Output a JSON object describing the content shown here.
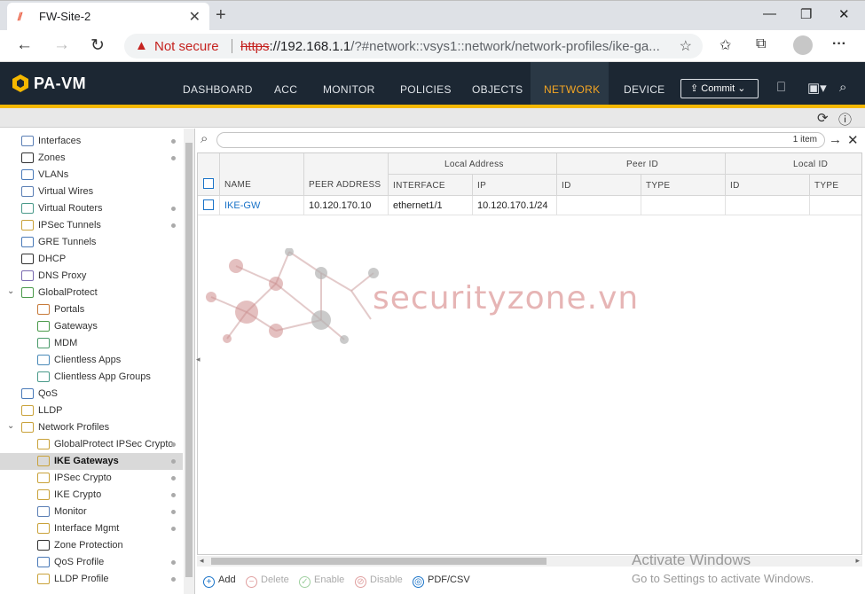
{
  "browser": {
    "tab_title": "FW-Site-2",
    "tab_close": "✕",
    "new_tab": "+",
    "not_secure": "Not secure",
    "url_scheme": "https",
    "url_host": "://192.168.1.1",
    "url_path": "/?#network::vsys1::network/network-profiles/ike-ga..."
  },
  "app": {
    "logo": "PA-VM",
    "nav": [
      "DASHBOARD",
      "ACC",
      "MONITOR",
      "POLICIES",
      "OBJECTS",
      "NETWORK",
      "DEVICE"
    ],
    "active_nav": "NETWORK",
    "commit_label": "Commit"
  },
  "sidebar": {
    "items": [
      {
        "label": "Interfaces",
        "dot": true
      },
      {
        "label": "Zones",
        "dot": true
      },
      {
        "label": "VLANs",
        "dot": false
      },
      {
        "label": "Virtual Wires",
        "dot": false
      },
      {
        "label": "Virtual Routers",
        "dot": true
      },
      {
        "label": "IPSec Tunnels",
        "dot": true
      },
      {
        "label": "GRE Tunnels",
        "dot": false
      },
      {
        "label": "DHCP",
        "dot": false
      },
      {
        "label": "DNS Proxy",
        "dot": false
      },
      {
        "label": "GlobalProtect",
        "dot": false
      },
      {
        "label": "Portals",
        "dot": false
      },
      {
        "label": "Gateways",
        "dot": false
      },
      {
        "label": "MDM",
        "dot": false
      },
      {
        "label": "Clientless Apps",
        "dot": false
      },
      {
        "label": "Clientless App Groups",
        "dot": false
      },
      {
        "label": "QoS",
        "dot": false
      },
      {
        "label": "LLDP",
        "dot": false
      },
      {
        "label": "Network Profiles",
        "dot": false
      },
      {
        "label": "GlobalProtect IPSec Crypto",
        "dot": true
      },
      {
        "label": "IKE Gateways",
        "dot": true
      },
      {
        "label": "IPSec Crypto",
        "dot": true
      },
      {
        "label": "IKE Crypto",
        "dot": true
      },
      {
        "label": "Monitor",
        "dot": true
      },
      {
        "label": "Interface Mgmt",
        "dot": true
      },
      {
        "label": "Zone Protection",
        "dot": false
      },
      {
        "label": "QoS Profile",
        "dot": true
      },
      {
        "label": "LLDP Profile",
        "dot": true
      }
    ],
    "selected": "IKE Gateways"
  },
  "grid": {
    "item_count": "1 item",
    "group_headers": {
      "local_address": "Local Address",
      "peer_id": "Peer ID",
      "local_id": "Local ID"
    },
    "columns": {
      "name": "NAME",
      "peer_address": "PEER ADDRESS",
      "interface": "INTERFACE",
      "ip": "IP",
      "peer_id": "ID",
      "peer_type": "TYPE",
      "local_id": "ID",
      "local_type": "TYPE"
    },
    "rows": [
      {
        "name": "IKE-GW",
        "peer_address": "10.120.170.10",
        "interface": "ethernet1/1",
        "ip": "10.120.170.1/24",
        "peer_id": "",
        "peer_type": "",
        "local_id": "",
        "local_type": ""
      }
    ]
  },
  "actions": {
    "add": "Add",
    "delete": "Delete",
    "enable": "Enable",
    "disable": "Disable",
    "pdf_csv": "PDF/CSV"
  },
  "overlay": {
    "watermark": "securityzone.vn",
    "activate_title": "Activate Windows",
    "activate_sub": "Go to Settings to activate Windows."
  },
  "colors": {
    "header_bg": "#1c2733",
    "accent": "#f5b800",
    "active_nav": "#f5a623",
    "link": "#1a73c8"
  }
}
